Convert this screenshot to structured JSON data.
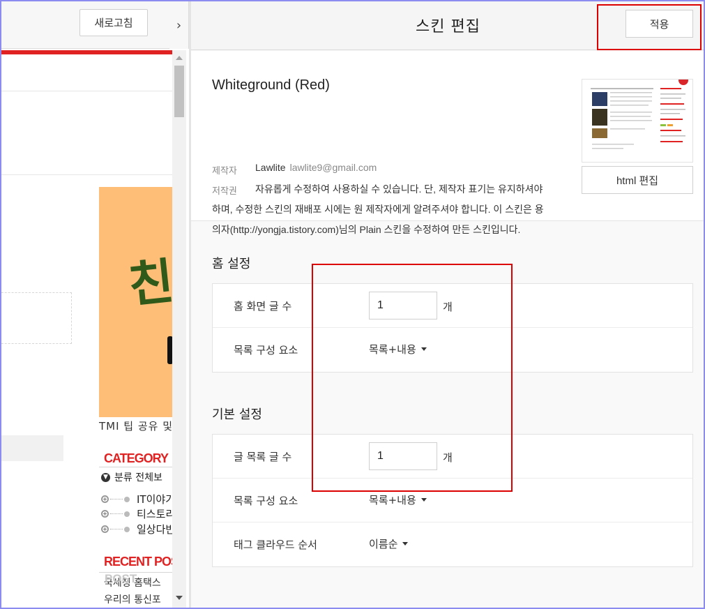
{
  "left": {
    "refresh_label": "새로고침",
    "collapse_icon": "›",
    "banner_char": "친",
    "banner_caption": "TMI 팁 공유 및",
    "category_title": "CATEGORY",
    "category_root": "분류 전체보",
    "categories": [
      "IT이야기",
      "티스토리",
      "일상다반"
    ],
    "recent_title": "RECENT POST",
    "post_overlay": "POST",
    "recent_items": [
      "국세청 홈택스",
      "우리의 통신포"
    ]
  },
  "header": {
    "title": "스킨 편집",
    "apply_label": "적용"
  },
  "skin": {
    "name": "Whiteground (Red)",
    "maker_label": "제작자",
    "maker_name": "Lawlite",
    "maker_email": "lawlite9@gmail.com",
    "copyright_label": "저작권",
    "copyright_line1": "자유롭게 수정하여 사용하실 수 있습니다. 단, 제작자 표기는 유지하셔야",
    "copyright_line2": "하며, 수정한 스킨의 재배포 시에는 원 제작자에게 알려주셔야 합니다. 이 스킨은 용",
    "copyright_line3": "의자(http://yongja.tistory.com)님의 Plain 스킨을 수정하여 만든 스킨입니다.",
    "html_edit_label": "html 편집"
  },
  "home_settings": {
    "heading": "홈 설정",
    "post_count_label": "홈 화면 글 수",
    "post_count_value": "1",
    "unit": "개",
    "list_component_label": "목록 구성 요소",
    "list_component_value": "목록+내용"
  },
  "basic_settings": {
    "heading": "기본 설정",
    "post_count_label": "글 목록 글 수",
    "post_count_value": "1",
    "unit": "개",
    "list_component_label": "목록 구성 요소",
    "list_component_value": "목록+내용",
    "tag_order_label": "태그 클라우드 순서",
    "tag_order_value": "이름순"
  },
  "colors": {
    "accent_red": "#e02222",
    "highlight_red": "#dd0000",
    "banner_orange": "#ffbe78",
    "frame_border": "#8c8cf0"
  }
}
